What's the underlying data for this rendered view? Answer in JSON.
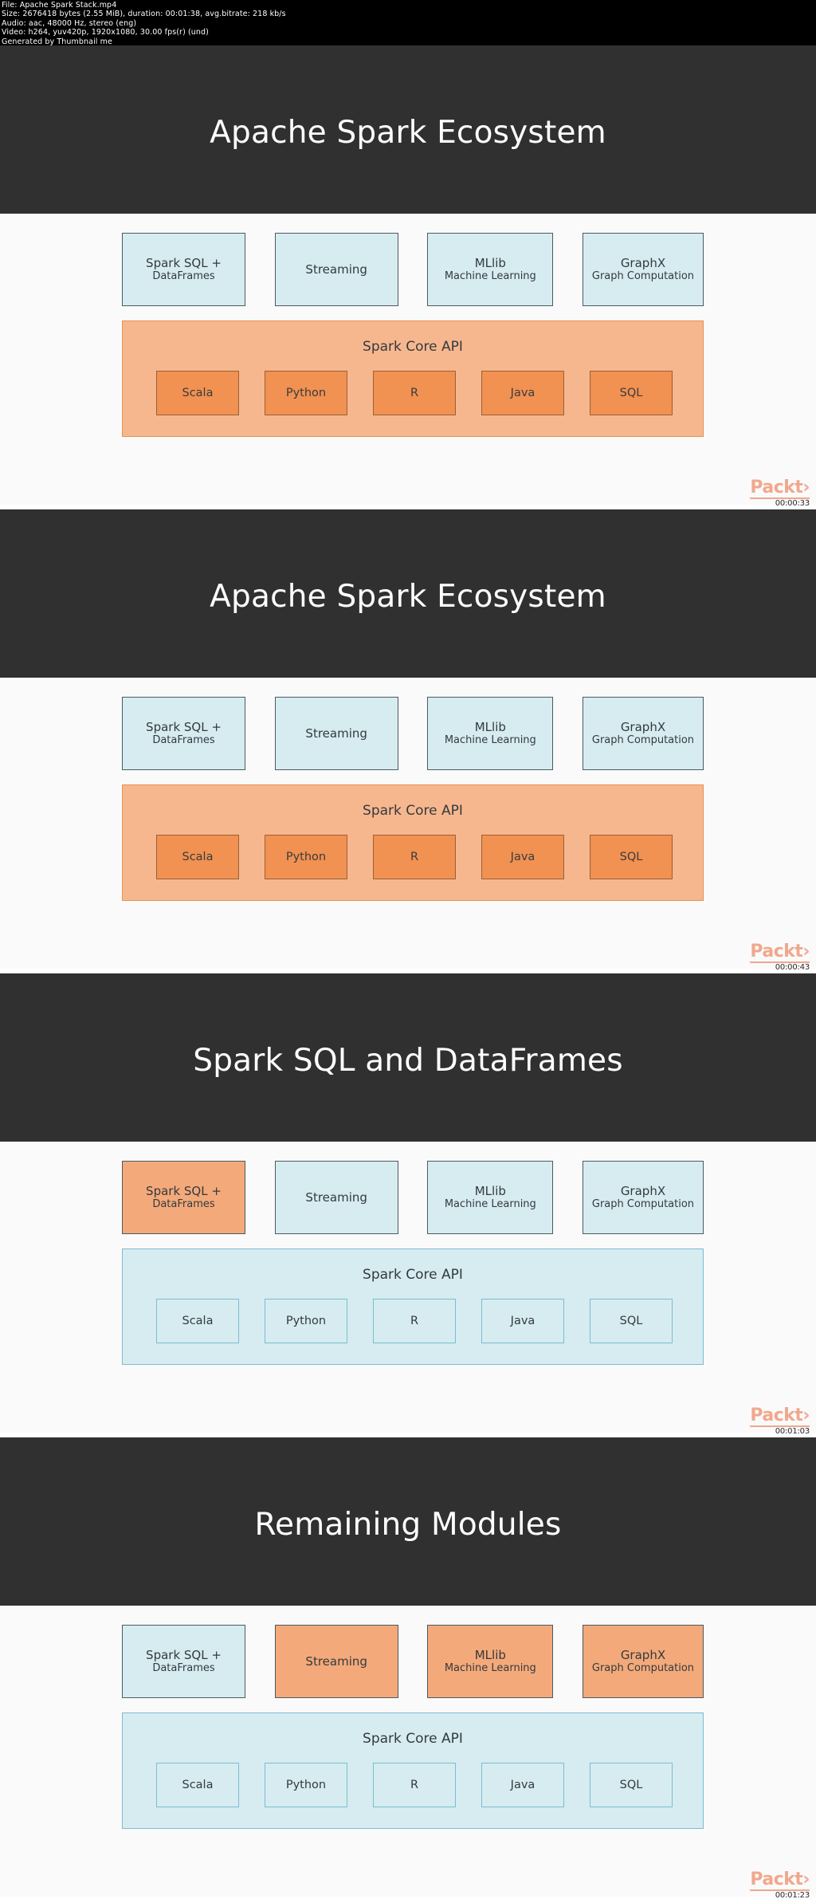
{
  "info_header": {
    "lines": [
      "File: Apache Spark Stack.mp4",
      "Size: 2676418 bytes (2.55 MiB), duration: 00:01:38, avg.bitrate: 218 kb/s",
      "Audio: aac, 48000 Hz, stereo (eng)",
      "Video: h264, yuv420p, 1920x1080, 30.00 fps(r) (und)",
      "Generated by Thumbnail me"
    ]
  },
  "colors": {
    "title_band": "#303030",
    "module_cool_fill": "#d6ecf1",
    "module_highlight_fill": "#f4a97a",
    "core_warm_fill": "#f7b78e",
    "core_cool_fill": "#d6ecf1",
    "lang_warm_fill": "#f19152",
    "lang_cool_fill": "#d6ecf1",
    "packt_brand": "#f0a88c",
    "slide_bg": "#fafafa"
  },
  "watermark": {
    "logo_text": "Packt›"
  },
  "frames": [
    {
      "title": "Apache Spark Ecosystem",
      "timestamp": "00:00:33",
      "modules": [
        {
          "main": "Spark SQL +",
          "sub": "DataFrames",
          "highlight": false
        },
        {
          "main": "Streaming",
          "sub": "",
          "highlight": false
        },
        {
          "main": "MLlib",
          "sub": "Machine Learning",
          "highlight": false
        },
        {
          "main": "GraphX",
          "sub": "Graph Computation",
          "highlight": false
        }
      ],
      "core": {
        "title": "Spark Core API",
        "warm": true,
        "languages": [
          "Scala",
          "Python",
          "R",
          "Java",
          "SQL"
        ]
      }
    },
    {
      "title": "Apache Spark Ecosystem",
      "timestamp": "00:00:43",
      "modules": [
        {
          "main": "Spark SQL +",
          "sub": "DataFrames",
          "highlight": false
        },
        {
          "main": "Streaming",
          "sub": "",
          "highlight": false
        },
        {
          "main": "MLlib",
          "sub": "Machine Learning",
          "highlight": false
        },
        {
          "main": "GraphX",
          "sub": "Graph Computation",
          "highlight": false
        }
      ],
      "core": {
        "title": "Spark Core API",
        "warm": true,
        "languages": [
          "Scala",
          "Python",
          "R",
          "Java",
          "SQL"
        ]
      }
    },
    {
      "title": "Spark SQL and DataFrames",
      "timestamp": "00:01:03",
      "modules": [
        {
          "main": "Spark SQL +",
          "sub": "DataFrames",
          "highlight": true
        },
        {
          "main": "Streaming",
          "sub": "",
          "highlight": false
        },
        {
          "main": "MLlib",
          "sub": "Machine Learning",
          "highlight": false
        },
        {
          "main": "GraphX",
          "sub": "Graph Computation",
          "highlight": false
        }
      ],
      "core": {
        "title": "Spark Core API",
        "warm": false,
        "languages": [
          "Scala",
          "Python",
          "R",
          "Java",
          "SQL"
        ]
      }
    },
    {
      "title": "Remaining Modules",
      "timestamp": "00:01:23",
      "modules": [
        {
          "main": "Spark SQL +",
          "sub": "DataFrames",
          "highlight": false
        },
        {
          "main": "Streaming",
          "sub": "",
          "highlight": true
        },
        {
          "main": "MLlib",
          "sub": "Machine Learning",
          "highlight": true
        },
        {
          "main": "GraphX",
          "sub": "Graph Computation",
          "highlight": true
        }
      ],
      "core": {
        "title": "Spark Core API",
        "warm": false,
        "languages": [
          "Scala",
          "Python",
          "R",
          "Java",
          "SQL"
        ]
      }
    }
  ]
}
